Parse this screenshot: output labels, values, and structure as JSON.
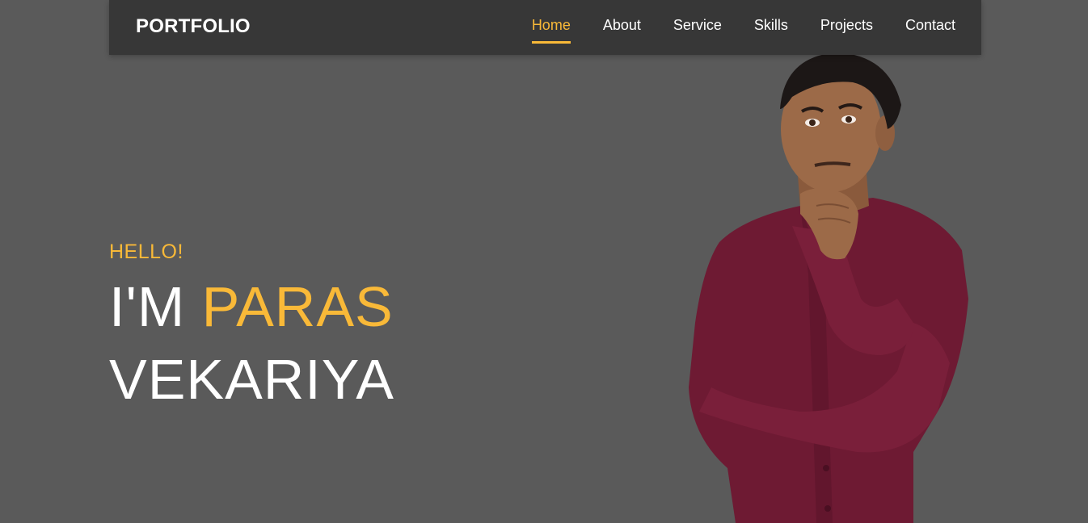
{
  "header": {
    "brand": "PORTFOLIO",
    "nav": [
      {
        "label": "Home",
        "active": true
      },
      {
        "label": "About"
      },
      {
        "label": "Service"
      },
      {
        "label": "Skills"
      },
      {
        "label": "Projects"
      },
      {
        "label": "Contact"
      }
    ]
  },
  "hero": {
    "greeting": "HELLO!",
    "prefix": "I'M",
    "first_name": "PARAS",
    "last_name": "VEKARIYA"
  },
  "colors": {
    "accent": "#f9b938",
    "background": "#5a5a5a",
    "navbar": "#373737",
    "text": "#ffffff",
    "shirt": "#6e1a33"
  }
}
